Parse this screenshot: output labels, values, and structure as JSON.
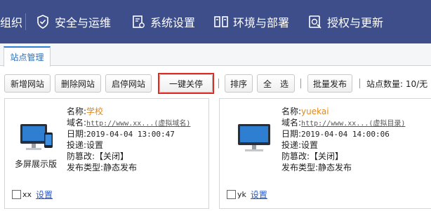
{
  "nav": {
    "items": [
      {
        "label": "组织",
        "icon": "org-icon"
      },
      {
        "label": "安全与运维",
        "icon": "shield-check-icon"
      },
      {
        "label": "系统设置",
        "icon": "settings-document-icon"
      },
      {
        "label": "环境与部署",
        "icon": "servers-icon"
      },
      {
        "label": "授权与更新",
        "icon": "license-icon"
      }
    ],
    "bg_color": "#3d4e8a"
  },
  "tabs": [
    {
      "label": "站点管理",
      "active": true
    }
  ],
  "toolbar": {
    "new_site": "新增网站",
    "delete_site": "删除网站",
    "toggle_site": "启停网站",
    "stop_all": "一键关停",
    "sort": "排序",
    "select_all": "全　选",
    "batch_publish": "批量发布",
    "site_count": "站点数量: 10/无"
  },
  "sites": [
    {
      "thumb_label": "多屏展示版",
      "name_key": "名称:",
      "name": "学校",
      "domain_key": "域名:",
      "domain": "http://www.xx...(虚拟域名)",
      "date_key": "日期:",
      "date": "2019-04-04 13:00:47",
      "delivery_key": "投递:",
      "delivery": "设置",
      "tamper_key": "防篡改:",
      "tamper": "【关闭】",
      "publish_key": "发布类型:",
      "publish": "静态发布",
      "code": "xx",
      "settings": "设置"
    },
    {
      "thumb_label": "",
      "name_key": "名称:",
      "name": "yuekai",
      "domain_key": "域名:",
      "domain": "http://www.xx...(虚拟目录)",
      "date_key": "日期:",
      "date": "2019-04-04 14:00:06",
      "delivery_key": "投递:",
      "delivery": "设置",
      "tamper_key": "防篡改:",
      "tamper": "【关闭】",
      "publish_key": "发布类型:",
      "publish": "静态发布",
      "code": "yk",
      "settings": "设置"
    }
  ]
}
